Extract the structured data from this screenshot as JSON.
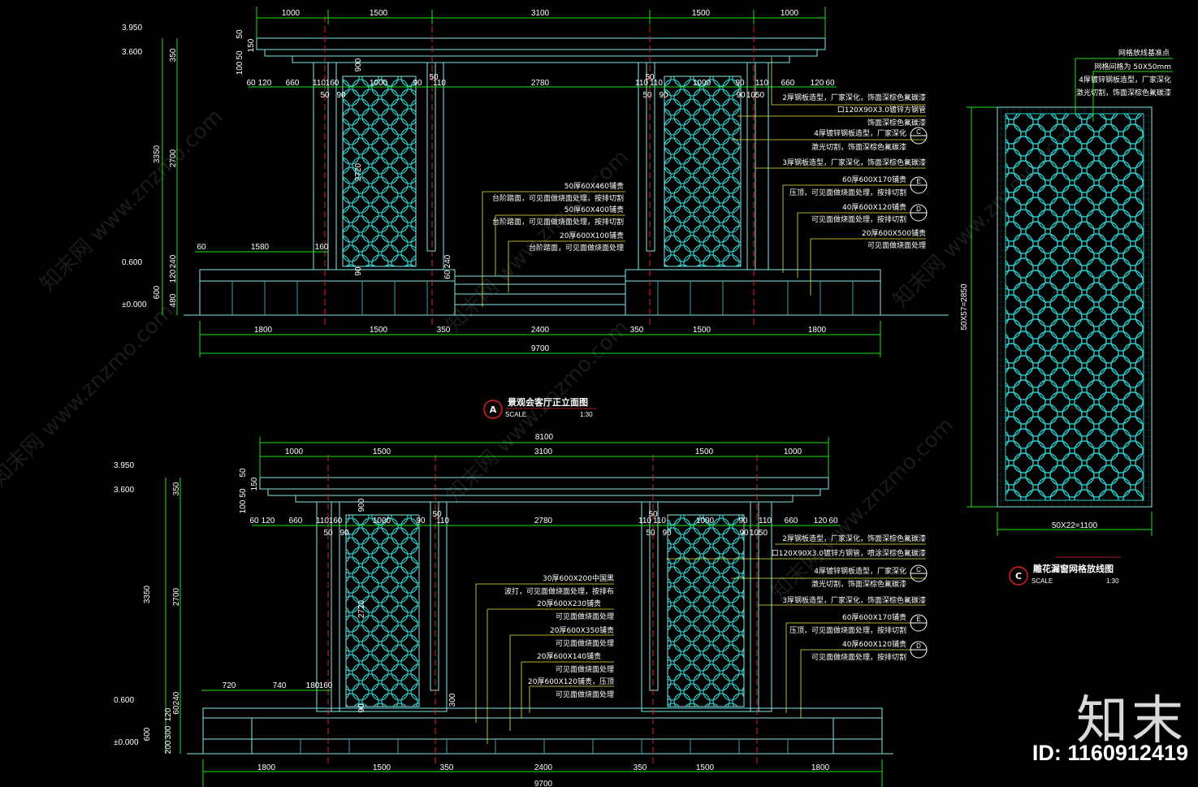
{
  "colors": {
    "dim": "#19e619",
    "outline": "#7fe8e8",
    "pattern": "#28c8c8",
    "red": "#e02020",
    "leader": "#e8e840",
    "white": "#ffffff"
  },
  "brand": {
    "logo": "知末",
    "id": "ID: 1160912419"
  },
  "watermark": "知末网 www.znzmo.com",
  "elevA": {
    "top_dims": [
      "1000",
      "1500",
      "3100",
      "1500",
      "1000"
    ],
    "sub_dims": [
      "60",
      "120",
      "660",
      "110",
      "160",
      "1000",
      "90",
      "110",
      "2780",
      "110",
      "110",
      "1000",
      "90",
      "110",
      "660",
      "120",
      "60"
    ],
    "small_dims": [
      "50",
      "90",
      "50",
      "50",
      "90",
      "50",
      "90",
      "1050"
    ],
    "bottom_dims": [
      "1800",
      "1500",
      "350",
      "2400",
      "350",
      "1500",
      "1800"
    ],
    "total": "9700",
    "left_levels": [
      "3.950",
      "3.600",
      "0.600",
      "±0.000"
    ],
    "left_dims": [
      "350",
      "2700",
      "240",
      "120",
      "480",
      "3350",
      "600",
      "50",
      "50",
      "150",
      "100"
    ],
    "inner_dims": [
      "60",
      "1580",
      "160",
      "2720",
      "90",
      "240",
      "60",
      "900"
    ],
    "callouts_mid": [
      "50厚60X460铺贵",
      "台阶踏面，可见面做烧面处理，按排切割",
      "50厚60X400铺贵",
      "台阶踏面，可见面做烧面处理，按排切割",
      "20厚600X100铺贵",
      "台阶踏面，可见面做烧面处理"
    ],
    "callouts_right": [
      "2厚钢板造型，厂家深化，饰面深棕色氟碳漆",
      "口120X90X3.0镀锌方钢管",
      "饰面深棕色氟碳漆",
      "4厚镀锌钢板造型，厂家深化",
      "激光切割，饰面深棕色氟碳漆",
      "3厚钢板造型，厂家深化，饰面深棕色氟碳漆",
      "60厚600X170铺贵",
      "压顶，可见面做烧面处理，按排切割",
      "40厚600X120铺贵",
      "可见面做烧面处理，按排切割",
      "20厚600X500铺贵",
      "可见面做烧面处理"
    ],
    "title": "景观会客厅正立面图",
    "scale_label": "SCALE",
    "scale": "1:30",
    "marker": "A",
    "refs": [
      "C",
      "E",
      "D"
    ]
  },
  "elevB": {
    "top_total": "8100",
    "top_dims": [
      "1000",
      "1500",
      "3100",
      "1500",
      "1000"
    ],
    "sub_dims": [
      "60",
      "120",
      "660",
      "110",
      "160",
      "1000",
      "90",
      "110",
      "2780",
      "110",
      "110",
      "1000",
      "90",
      "110",
      "660",
      "120",
      "60"
    ],
    "small_dims": [
      "50",
      "90",
      "50",
      "50",
      "90",
      "50",
      "90",
      "1050"
    ],
    "bottom_dims": [
      "1800",
      "1500",
      "350",
      "2400",
      "350",
      "1500",
      "1800"
    ],
    "total": "9700",
    "left_levels": [
      "3.950",
      "3.600",
      "0.600",
      "±0.000"
    ],
    "left_dims": [
      "350",
      "2700",
      "240",
      "60",
      "120",
      "300",
      "200",
      "3350",
      "600",
      "50",
      "50",
      "150",
      "100"
    ],
    "inner_dims": [
      "720",
      "740",
      "180",
      "160",
      "2720",
      "90",
      "300",
      "900"
    ],
    "callouts_mid": [
      "30厚600X200中国黑",
      "波打，可见面做烧面处理，按排布",
      "20厚600X230铺贵",
      "可见面做烧面处理",
      "20厚600X350铺贵",
      "可见面做烧面处理",
      "20厚600X140铺贵",
      "可见面做烧面处理",
      "20厚600X120铺贵，压顶",
      "可见面做烧面处理"
    ],
    "callouts_right": [
      "2厚钢板造型，厂家深化，饰面深棕色氟碳漆",
      "口120X90X3.0镀锌方钢管，喷涂深棕色氟碳漆",
      "4厚镀锌钢板造型，厂家深化",
      "激光切割，饰面深棕色氟碳漆",
      "3厚钢板造型，厂家深化，饰面深棕色氟碳漆",
      "60厚600X170铺贵",
      "压顶，可见面做烧面处理，按排切割",
      "40厚600X120铺贵",
      "可见面做烧面处理，按排切割"
    ],
    "refs": [
      "C",
      "E",
      "D"
    ]
  },
  "detailC": {
    "notes": [
      "网格放线基准点",
      "网格间格为 50X50mm",
      "4厚镀锌钢板造型，厂家深化",
      "激光切割，饰面深棕色氟碳漆"
    ],
    "height_dim": "50X57=2850",
    "width_dim": "50X22=1100",
    "title": "雕花漏窗网格放线图",
    "scale_label": "SCALE",
    "scale": "1:30",
    "marker": "C"
  }
}
